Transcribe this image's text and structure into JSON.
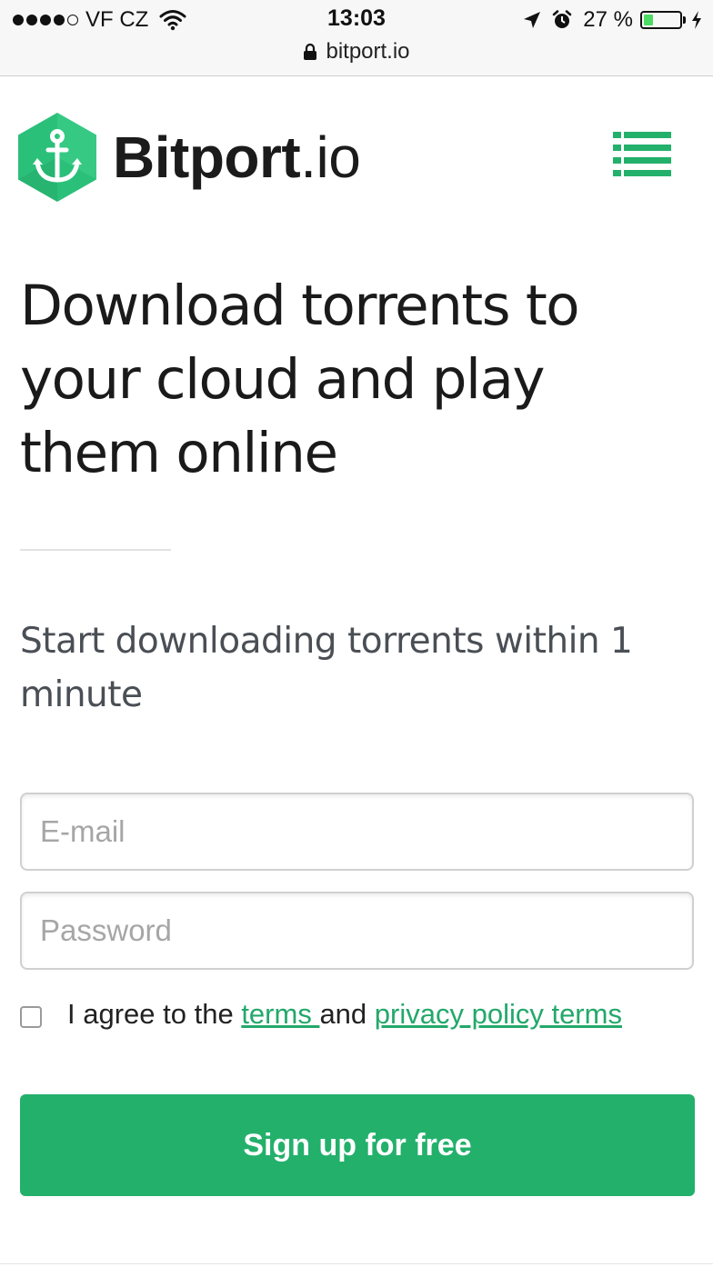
{
  "status_bar": {
    "carrier": "VF CZ",
    "signal_dots_filled": 4,
    "signal_dots_total": 5,
    "time": "13:03",
    "url": "bitport.io",
    "battery_percent": "27 %",
    "battery_level": 0.27,
    "battery_color": "#4cd964"
  },
  "header": {
    "logo_name": "Bitport",
    "logo_tld": ".io",
    "logo_icon": "anchor-icon",
    "menu_icon": "list-menu-icon"
  },
  "hero": {
    "title": "Download torrents to your cloud and play them online",
    "subtitle": "Start downloading torrents within 1 minute"
  },
  "form": {
    "email_placeholder": "E-mail",
    "password_placeholder": "Password",
    "agree_prefix": "I agree to the ",
    "terms_link": "terms ",
    "agree_middle": "and ",
    "privacy_link": "privacy policy terms",
    "submit_label": "Sign up for free"
  },
  "colors": {
    "accent": "#23b06b",
    "link": "#23a86a",
    "logo_green": "#2bc07a"
  }
}
